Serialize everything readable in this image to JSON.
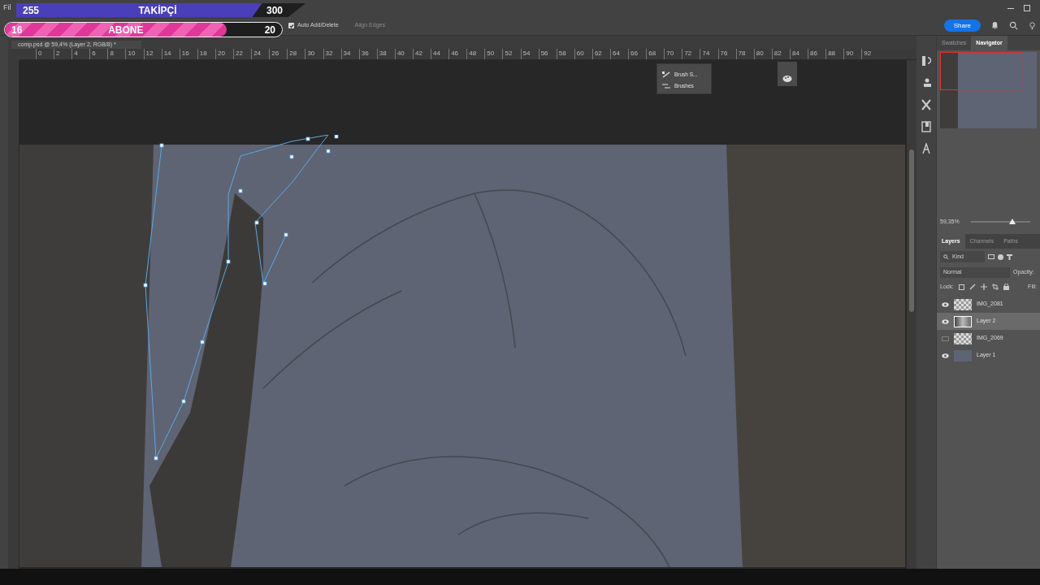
{
  "menu": {
    "label": "Fil"
  },
  "options_bar": {
    "auto_add_delete": {
      "label": "Auto Add/Delete",
      "checked": true
    },
    "align_edges": {
      "label": "Align Edges",
      "disabled": true
    }
  },
  "top_right": {
    "share": "Share"
  },
  "document_tab": {
    "title": "comp.psd @ 59,4% (Layer 2, RGB/8) *"
  },
  "ruler": {
    "ticks": [
      "0",
      "2",
      "4",
      "6",
      "8",
      "10",
      "12",
      "14",
      "16",
      "18",
      "20",
      "22",
      "24",
      "26",
      "28",
      "30",
      "32",
      "34",
      "36",
      "38",
      "40",
      "42",
      "44",
      "46",
      "48",
      "50",
      "52",
      "54",
      "56",
      "58",
      "60",
      "62",
      "64",
      "66",
      "68",
      "70",
      "72",
      "74",
      "76",
      "78",
      "80",
      "82",
      "84",
      "86",
      "88",
      "90",
      "92"
    ]
  },
  "floating_panel": {
    "items": [
      {
        "label": "Brush S..."
      },
      {
        "label": "Brushes"
      }
    ]
  },
  "panel_tabs": [
    {
      "label": "Swatches",
      "selected": false
    },
    {
      "label": "Navigator",
      "selected": true
    }
  ],
  "navigator": {
    "zoom": "59,35%",
    "level": 0.7
  },
  "layer_tabs": [
    {
      "label": "Layers",
      "selected": true
    },
    {
      "label": "Channels",
      "selected": false
    },
    {
      "label": "Paths",
      "selected": false
    }
  ],
  "layer_controls": {
    "filter": "Kind",
    "blend_mode": "Normal",
    "opacity_label": "Opacity:",
    "lock_label": "Lock:",
    "fill_label": "Fill:"
  },
  "layers": [
    {
      "name": "IMG_2081",
      "visible": true,
      "selected": false,
      "kind": "transparent"
    },
    {
      "name": "Layer 2",
      "visible": true,
      "selected": true,
      "kind": "painted"
    },
    {
      "name": "IMG_2069",
      "visible": false,
      "selected": false,
      "kind": "transparent"
    },
    {
      "name": "Layer 1",
      "visible": true,
      "selected": false,
      "kind": "solid"
    }
  ],
  "stream_overlay": {
    "followers": {
      "current": "255",
      "label": "TAKİPÇİ",
      "goal": "300",
      "level": 0.85
    },
    "subscribers": {
      "current": "16",
      "label": "ABONE",
      "goal": "20",
      "level": 0.8
    }
  }
}
